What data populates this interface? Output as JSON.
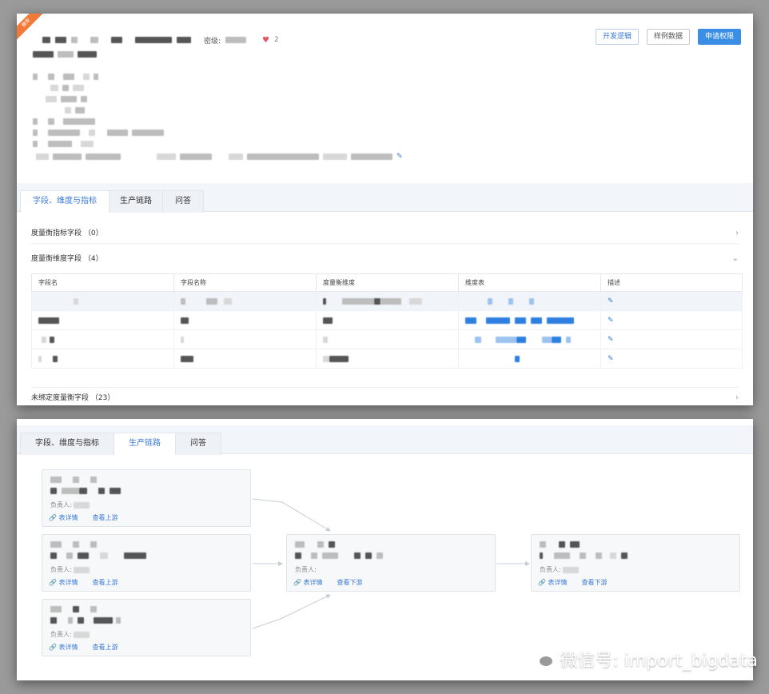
{
  "top": {
    "ribbon": "推荐",
    "secret_label": "密级:",
    "likes": "2",
    "buttons": {
      "dev_logic": "开发逻辑",
      "sample_data": "样例数据",
      "apply": "申请权限"
    },
    "tabs": [
      "字段、维度与指标",
      "生产链路",
      "问答"
    ],
    "sections": {
      "metric_fields": "度量衡指标字段 （0）",
      "dimension_fields": "度量衡维度字段 （4）",
      "unbound_fields": "未绑定度量衡字段 （23）"
    },
    "table": {
      "headers": [
        "字段名",
        "字段名称",
        "度量衡维度",
        "维度表",
        "描述"
      ]
    }
  },
  "bottom": {
    "tabs": [
      "字段、维度与指标",
      "生产链路",
      "问答"
    ],
    "owner_label": "负责人:",
    "link_table_detail": "表详情",
    "link_upstream": "查看上游",
    "link_downstream": "查看下游"
  },
  "watermark": "微信号: import_bigdata",
  "colors": {
    "accent": "#3a8ee6",
    "ribbon": "#f27a38",
    "like": "#e25563"
  }
}
